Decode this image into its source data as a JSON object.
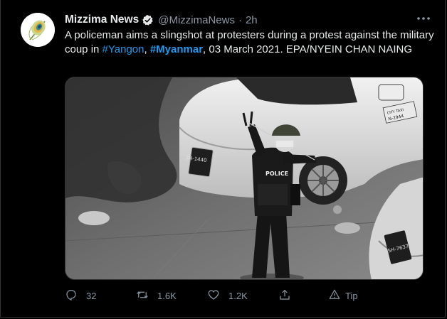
{
  "tweet": {
    "author_name": "Mizzima News",
    "handle": "@MizzimaNews",
    "separator": "·",
    "time": "2h",
    "text_part1": "A policeman aims a slingshot at protesters during a protest against the military coup in ",
    "hashtag1": "#Yangon",
    "text_part2": ", ",
    "hashtag2": "#Myanmar",
    "text_part3": ", 03 March 2021. EPA/NYEIN CHAN NAING"
  },
  "media": {
    "plate_left": "3H-1440",
    "plate_right": "5H-7637",
    "police_label": "POLICE",
    "taxi_sign": "CITY TAXI",
    "taxi_number": "N-2944"
  },
  "actions": {
    "reply_count": "32",
    "retweet_count": "1.6K",
    "like_count": "1.2K",
    "tip_label": "Tip"
  },
  "colors": {
    "background": "#000000",
    "accent": "#1d9bf0",
    "muted": "#8b98a5"
  },
  "icons": [
    "verified-badge-icon",
    "more-icon",
    "reply-icon",
    "retweet-icon",
    "like-icon",
    "share-icon",
    "tip-icon"
  ]
}
